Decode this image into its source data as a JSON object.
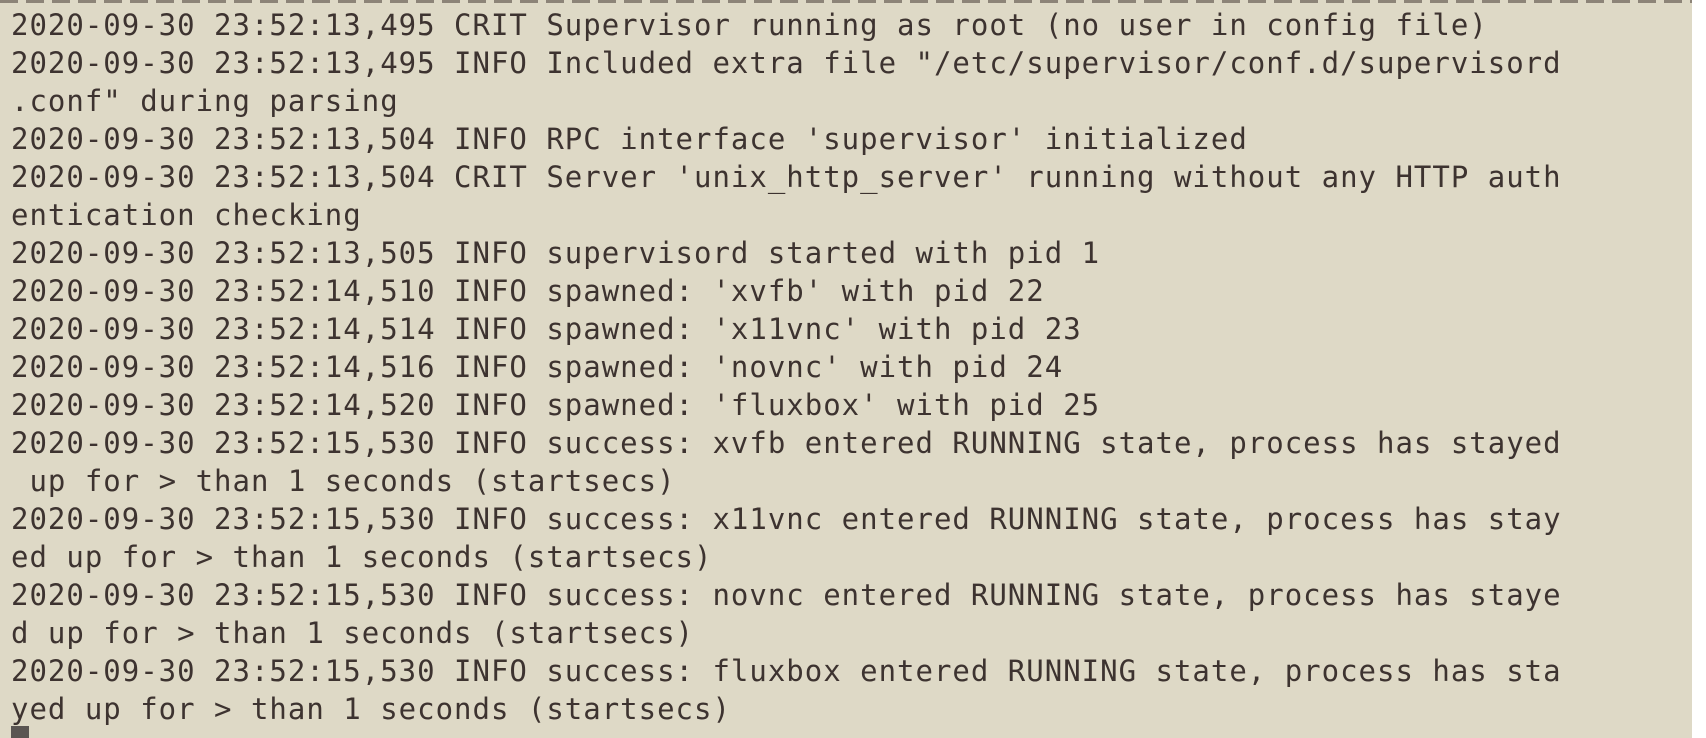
{
  "terminal": {
    "lines": [
      "2020-09-30 23:52:13,495 CRIT Supervisor running as root (no user in config file)",
      "2020-09-30 23:52:13,495 INFO Included extra file \"/etc/supervisor/conf.d/supervisord",
      ".conf\" during parsing",
      "2020-09-30 23:52:13,504 INFO RPC interface 'supervisor' initialized",
      "2020-09-30 23:52:13,504 CRIT Server 'unix_http_server' running without any HTTP auth",
      "entication checking",
      "2020-09-30 23:52:13,505 INFO supervisord started with pid 1",
      "2020-09-30 23:52:14,510 INFO spawned: 'xvfb' with pid 22",
      "2020-09-30 23:52:14,514 INFO spawned: 'x11vnc' with pid 23",
      "2020-09-30 23:52:14,516 INFO spawned: 'novnc' with pid 24",
      "2020-09-30 23:52:14,520 INFO spawned: 'fluxbox' with pid 25",
      "2020-09-30 23:52:15,530 INFO success: xvfb entered RUNNING state, process has stayed",
      " up for > than 1 seconds (startsecs)",
      "2020-09-30 23:52:15,530 INFO success: x11vnc entered RUNNING state, process has stay",
      "ed up for > than 1 seconds (startsecs)",
      "2020-09-30 23:52:15,530 INFO success: novnc entered RUNNING state, process has staye",
      "d up for > than 1 seconds (startsecs)",
      "2020-09-30 23:52:15,530 INFO success: fluxbox entered RUNNING state, process has sta",
      "yed up for > than 1 seconds (startsecs)"
    ]
  },
  "colors": {
    "background": "#ded9c6",
    "text": "#3d3330",
    "cursor": "#5a5552"
  }
}
